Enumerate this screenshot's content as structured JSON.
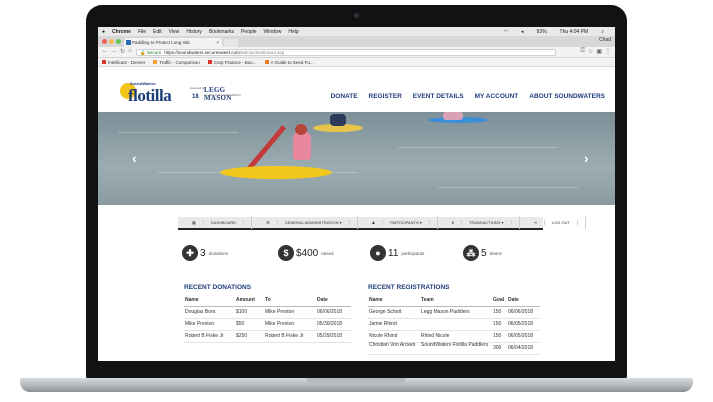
{
  "menubar": {
    "app": "Chrome",
    "items": [
      "File",
      "Edit",
      "View",
      "History",
      "Bookmarks",
      "People",
      "Window",
      "Help"
    ],
    "battery": "93%",
    "time": "Thu 4:04 PM"
  },
  "tabs": {
    "active_title": "Paddling to Protect Long Isla",
    "close": "×",
    "profile": "Chad"
  },
  "address": {
    "secure_label": "Secure",
    "scheme": "https://",
    "host": "soundwaters.securesweet.com",
    "path": "/admin/dashboard.asp"
  },
  "bookmarks": [
    {
      "label": "Intellicast - Denver",
      "color": "#d9352b"
    },
    {
      "label": "Traffic - Comparison",
      "color": "#f2a134"
    },
    {
      "label": "Corp Finance - Boo...",
      "color": "#d9352b"
    },
    {
      "label": "A Guide to Seed Fu...",
      "color": "#e67e22"
    }
  ],
  "site": {
    "logo_top": "SoundWaters",
    "logo_main": "flotilla",
    "logo_year": "18",
    "logo_presented": "presented by",
    "sponsor": "LEGG MASON",
    "sponsor_sub": "GLOBAL ASSET MANAGEMENT",
    "nav": [
      "DONATE",
      "REGISTER",
      "EVENT DETAILS",
      "MY ACCOUNT",
      "ABOUT SOUNDWATERS"
    ]
  },
  "hero": {
    "prev": "‹",
    "next": "›"
  },
  "dashnav": [
    "DASHBOARD",
    "GENERAL ADMINISTRATION ▾",
    "PARTICIPANTS ▾",
    "TRANSACTIONS ▾",
    "LOG OUT"
  ],
  "stats": {
    "donations": {
      "value": "3",
      "label": "donations",
      "icon": "gift-icon"
    },
    "raised": {
      "value": "$400",
      "label": "raised",
      "icon": "dollar-icon"
    },
    "participants": {
      "value": "11",
      "label": "participants",
      "icon": "person-icon"
    },
    "teams": {
      "value": "5",
      "label": "teams",
      "icon": "team-icon"
    }
  },
  "donations": {
    "title": "RECENT DONATIONS",
    "headers": [
      "Name",
      "Amount",
      "To",
      "Date"
    ],
    "rows": [
      [
        "Douglas Bora",
        "$100",
        "Mike Preston",
        "06/06/2018"
      ],
      [
        "Mike Preston",
        "$50",
        "Mike Preston",
        "05/30/2018"
      ],
      [
        "Robert B Fiske Jr",
        "$250",
        "Robert B Fiske Jr",
        "05/29/2018"
      ]
    ]
  },
  "registrations": {
    "title": "RECENT REGISTRATIONS",
    "headers": [
      "Name",
      "Team",
      "Goal",
      "Date"
    ],
    "rows": [
      [
        "George Schott",
        "Legg Mason Paddlers",
        "150",
        "06/06/2018"
      ],
      [
        "Jamie Rhind",
        "",
        "150",
        "06/05/2018"
      ],
      [
        "Nicole Rhind",
        "Rhind Nicole",
        "150",
        "06/05/2018"
      ],
      [
        "Christian Von Arcken",
        "SoundWaters Flotilla Paddlers",
        "300",
        "06/04/2018"
      ]
    ]
  }
}
